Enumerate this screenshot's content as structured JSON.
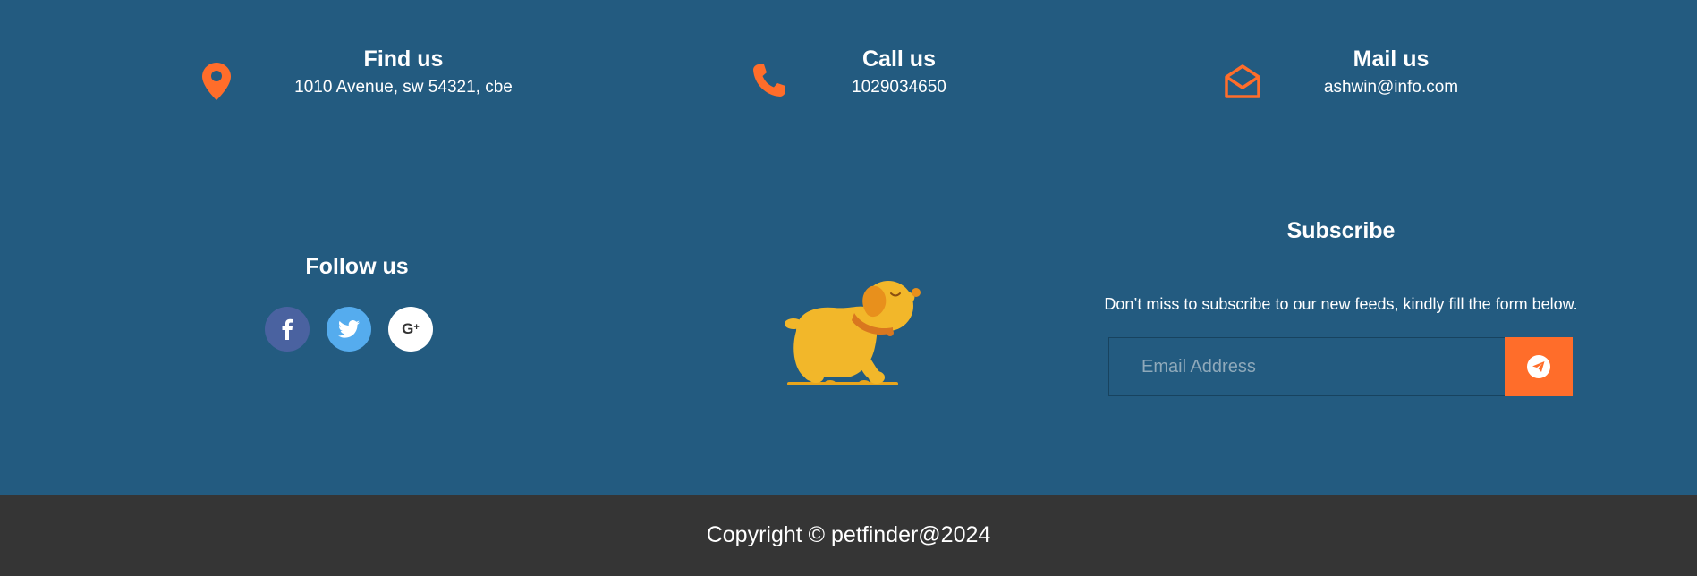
{
  "contacts": [
    {
      "title": "Find us",
      "value": "1010 Avenue, sw 54321, cbe",
      "icon": "map-pin-icon"
    },
    {
      "title": "Call us",
      "value": "1029034650",
      "icon": "phone-icon"
    },
    {
      "title": "Mail us",
      "value": "ashwin@info.com",
      "icon": "envelope-open-icon"
    }
  ],
  "follow": {
    "title": "Follow us",
    "networks": [
      "facebook-icon",
      "twitter-icon",
      "google-plus-icon"
    ]
  },
  "subscribe": {
    "title": "Subscribe",
    "text": "Don’t miss to subscribe to our new feeds, kindly fill the form below.",
    "placeholder": "Email Address",
    "button_icon": "paper-plane-icon"
  },
  "footer": {
    "copyright": "Copyright © petfinder@2024"
  },
  "colors": {
    "background": "#235b80",
    "accent": "#ff6d2a",
    "copyright_bg": "#353535",
    "facebook": "#4a62a0",
    "twitter": "#55acee"
  }
}
